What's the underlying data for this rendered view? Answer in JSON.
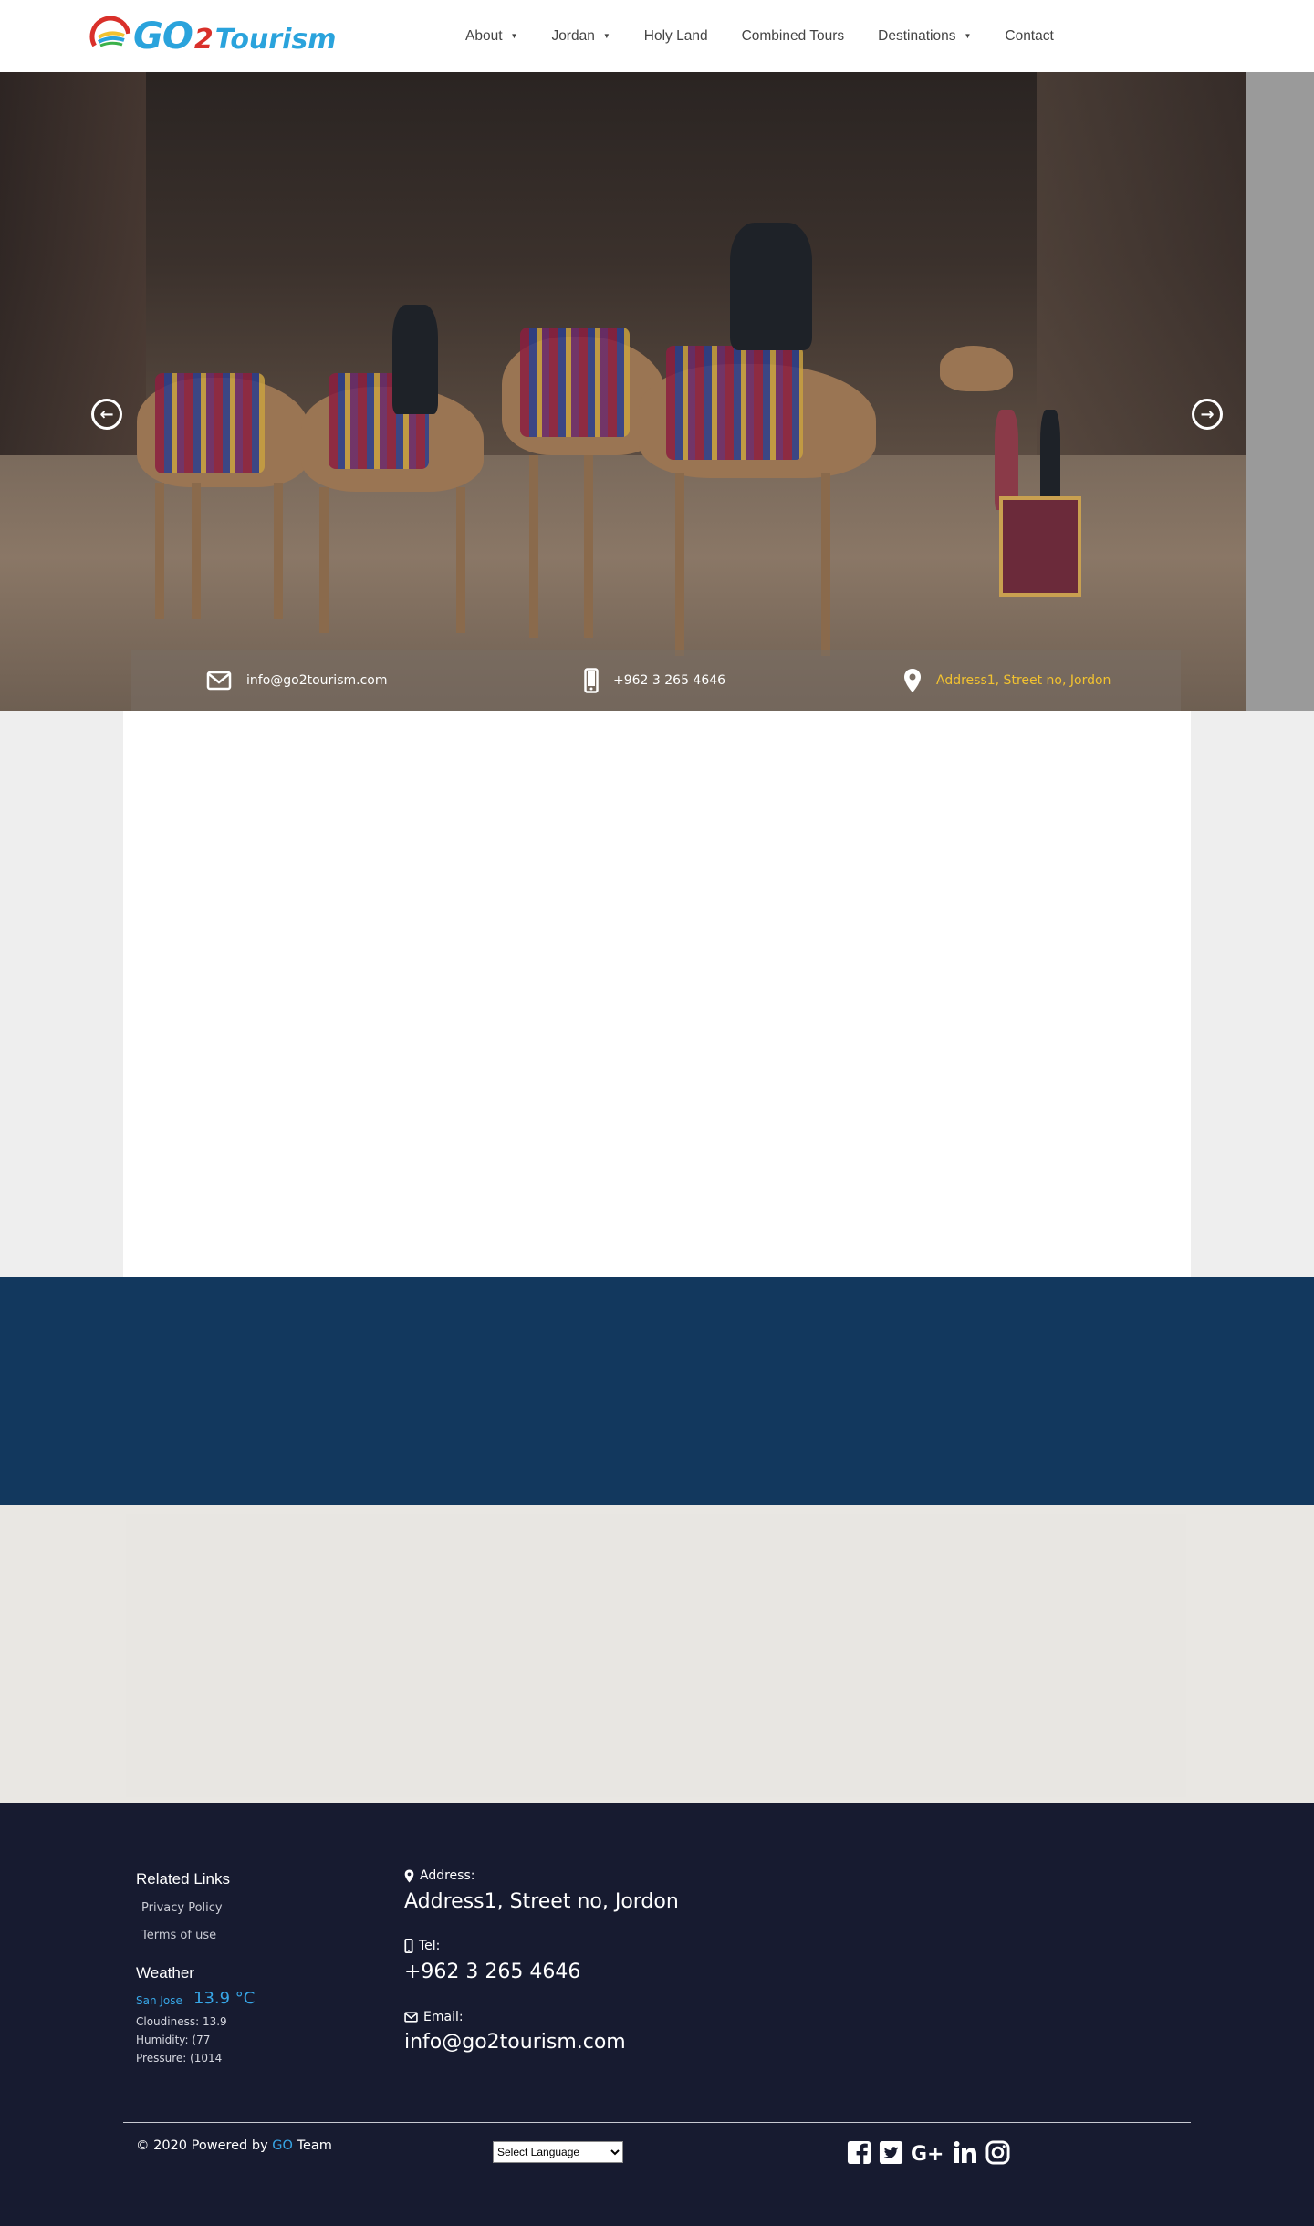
{
  "header": {
    "logo": {
      "go": "GO",
      "two": "2",
      "tourism": "Tourism"
    },
    "nav": [
      {
        "label": "About",
        "has_dropdown": true
      },
      {
        "label": "Jordan",
        "has_dropdown": true
      },
      {
        "label": "Holy Land",
        "has_dropdown": false
      },
      {
        "label": "Combined Tours",
        "has_dropdown": false
      },
      {
        "label": "Destinations",
        "has_dropdown": true
      },
      {
        "label": "Contact",
        "has_dropdown": false
      }
    ],
    "caret": "▼"
  },
  "hero": {
    "prev_icon": "arrow-left-circle-icon",
    "next_icon": "arrow-right-circle-icon",
    "prev_glyph": "←",
    "next_glyph": "→",
    "info": {
      "email": "info@go2tourism.com",
      "phone": "+962 3 265 4646",
      "address": "Address1, Street no, Jordon"
    }
  },
  "footer": {
    "related_links": {
      "heading": "Related Links",
      "links": [
        "Privacy Policy",
        "Terms of use"
      ]
    },
    "weather": {
      "heading": "Weather",
      "city": "San Jose",
      "temp": "13.9 °C",
      "cloudiness": "Cloudiness: 13.9",
      "humidity": "Humidity: (77",
      "pressure": "Pressure: (1014"
    },
    "contact": {
      "address_label": "Address:",
      "address_value": "Address1, Street no, Jordon",
      "tel_label": "Tel:",
      "tel_value": "+962 3 265 4646",
      "email_label": "Email:",
      "email_value": "info@go2tourism.com"
    },
    "copyright": {
      "prefix": "© 2020 Powered by ",
      "brand": "GO",
      "suffix": " Team"
    },
    "language_select": "Select Language",
    "social_icons": [
      "facebook-icon",
      "twitter-icon",
      "google-plus-icon",
      "linkedin-icon",
      "instagram-icon"
    ]
  },
  "colors": {
    "brand_blue": "#2aa3dc",
    "brand_red": "#d9302a",
    "band_blue": "#12385e",
    "footer_bg": "#171b30",
    "address_yellow": "#f2c230",
    "weather_blue": "#37a6e6"
  }
}
